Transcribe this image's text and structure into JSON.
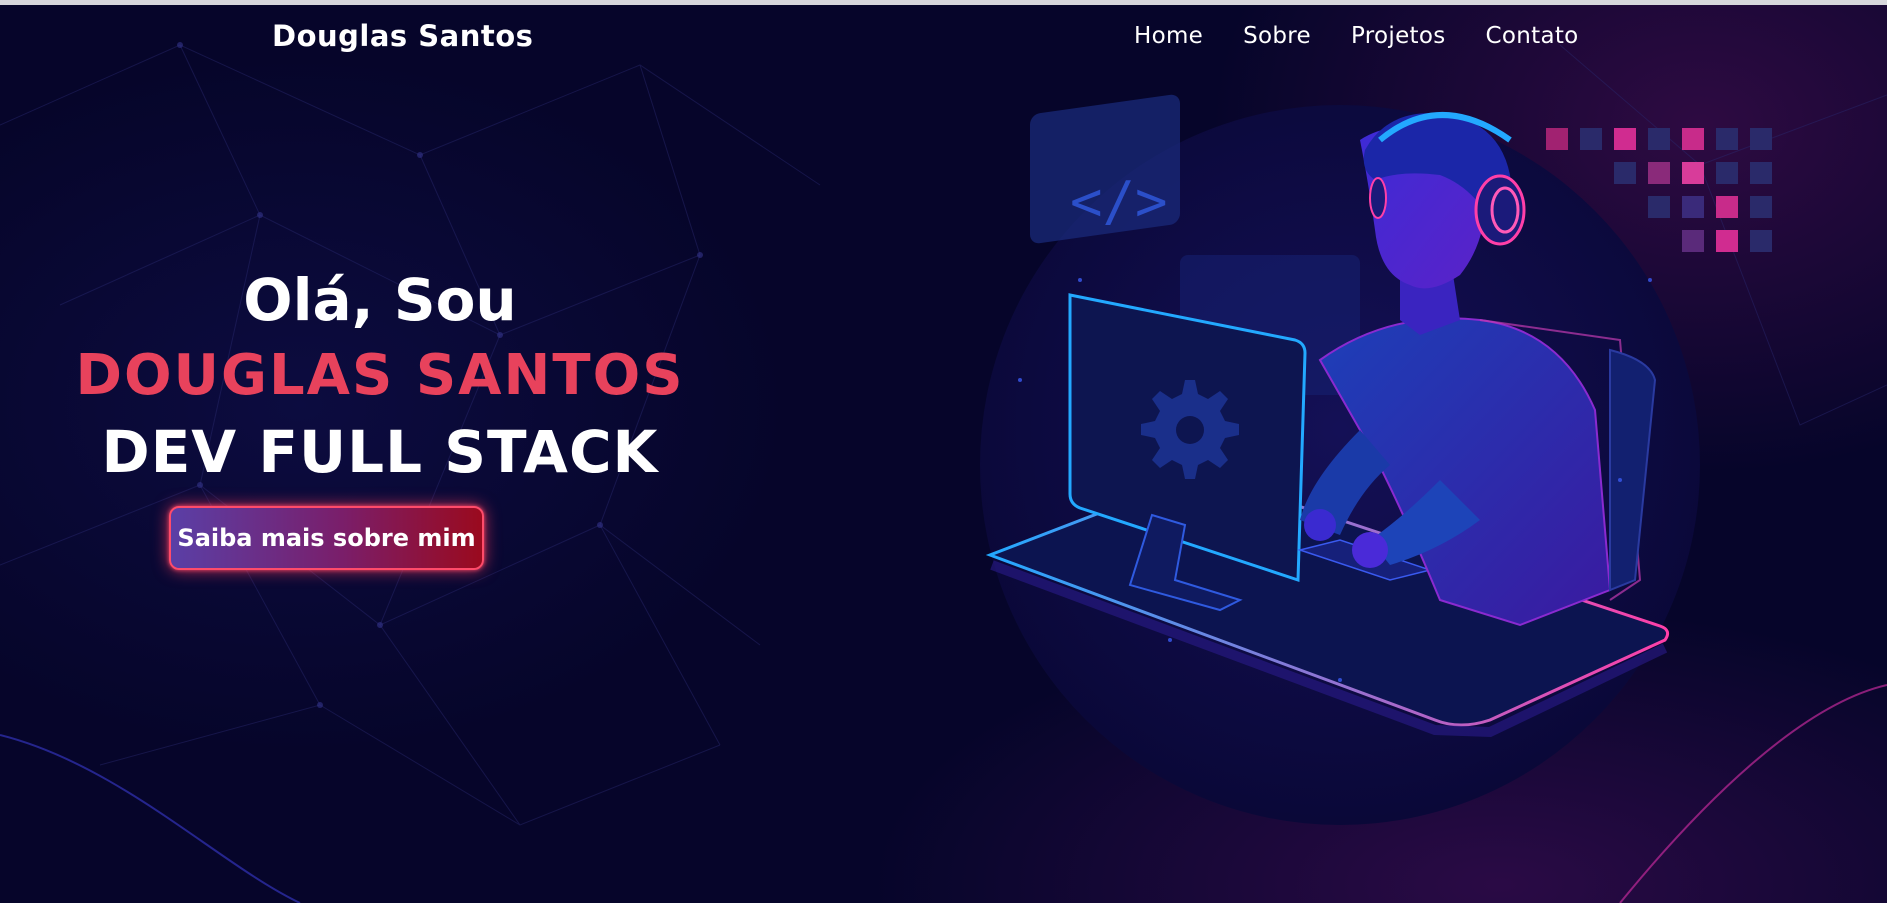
{
  "nav": {
    "brand": "Douglas Santos",
    "links": [
      {
        "label": "Home"
      },
      {
        "label": "Sobre"
      },
      {
        "label": "Projetos"
      },
      {
        "label": "Contato"
      }
    ]
  },
  "hero": {
    "greeting": "Olá, Sou",
    "name": "DOUGLAS SANTOS",
    "role": "DEV FULL STACK",
    "cta_label": "Saiba mais sobre mim"
  },
  "illustration": {
    "description_icon": "developer-at-computer-illustration",
    "code_icon_text": "</>"
  },
  "colors": {
    "background": "#06052a",
    "accent": "#e8425c",
    "neon_blue": "#23a9ff",
    "neon_pink": "#ff3fa8"
  }
}
